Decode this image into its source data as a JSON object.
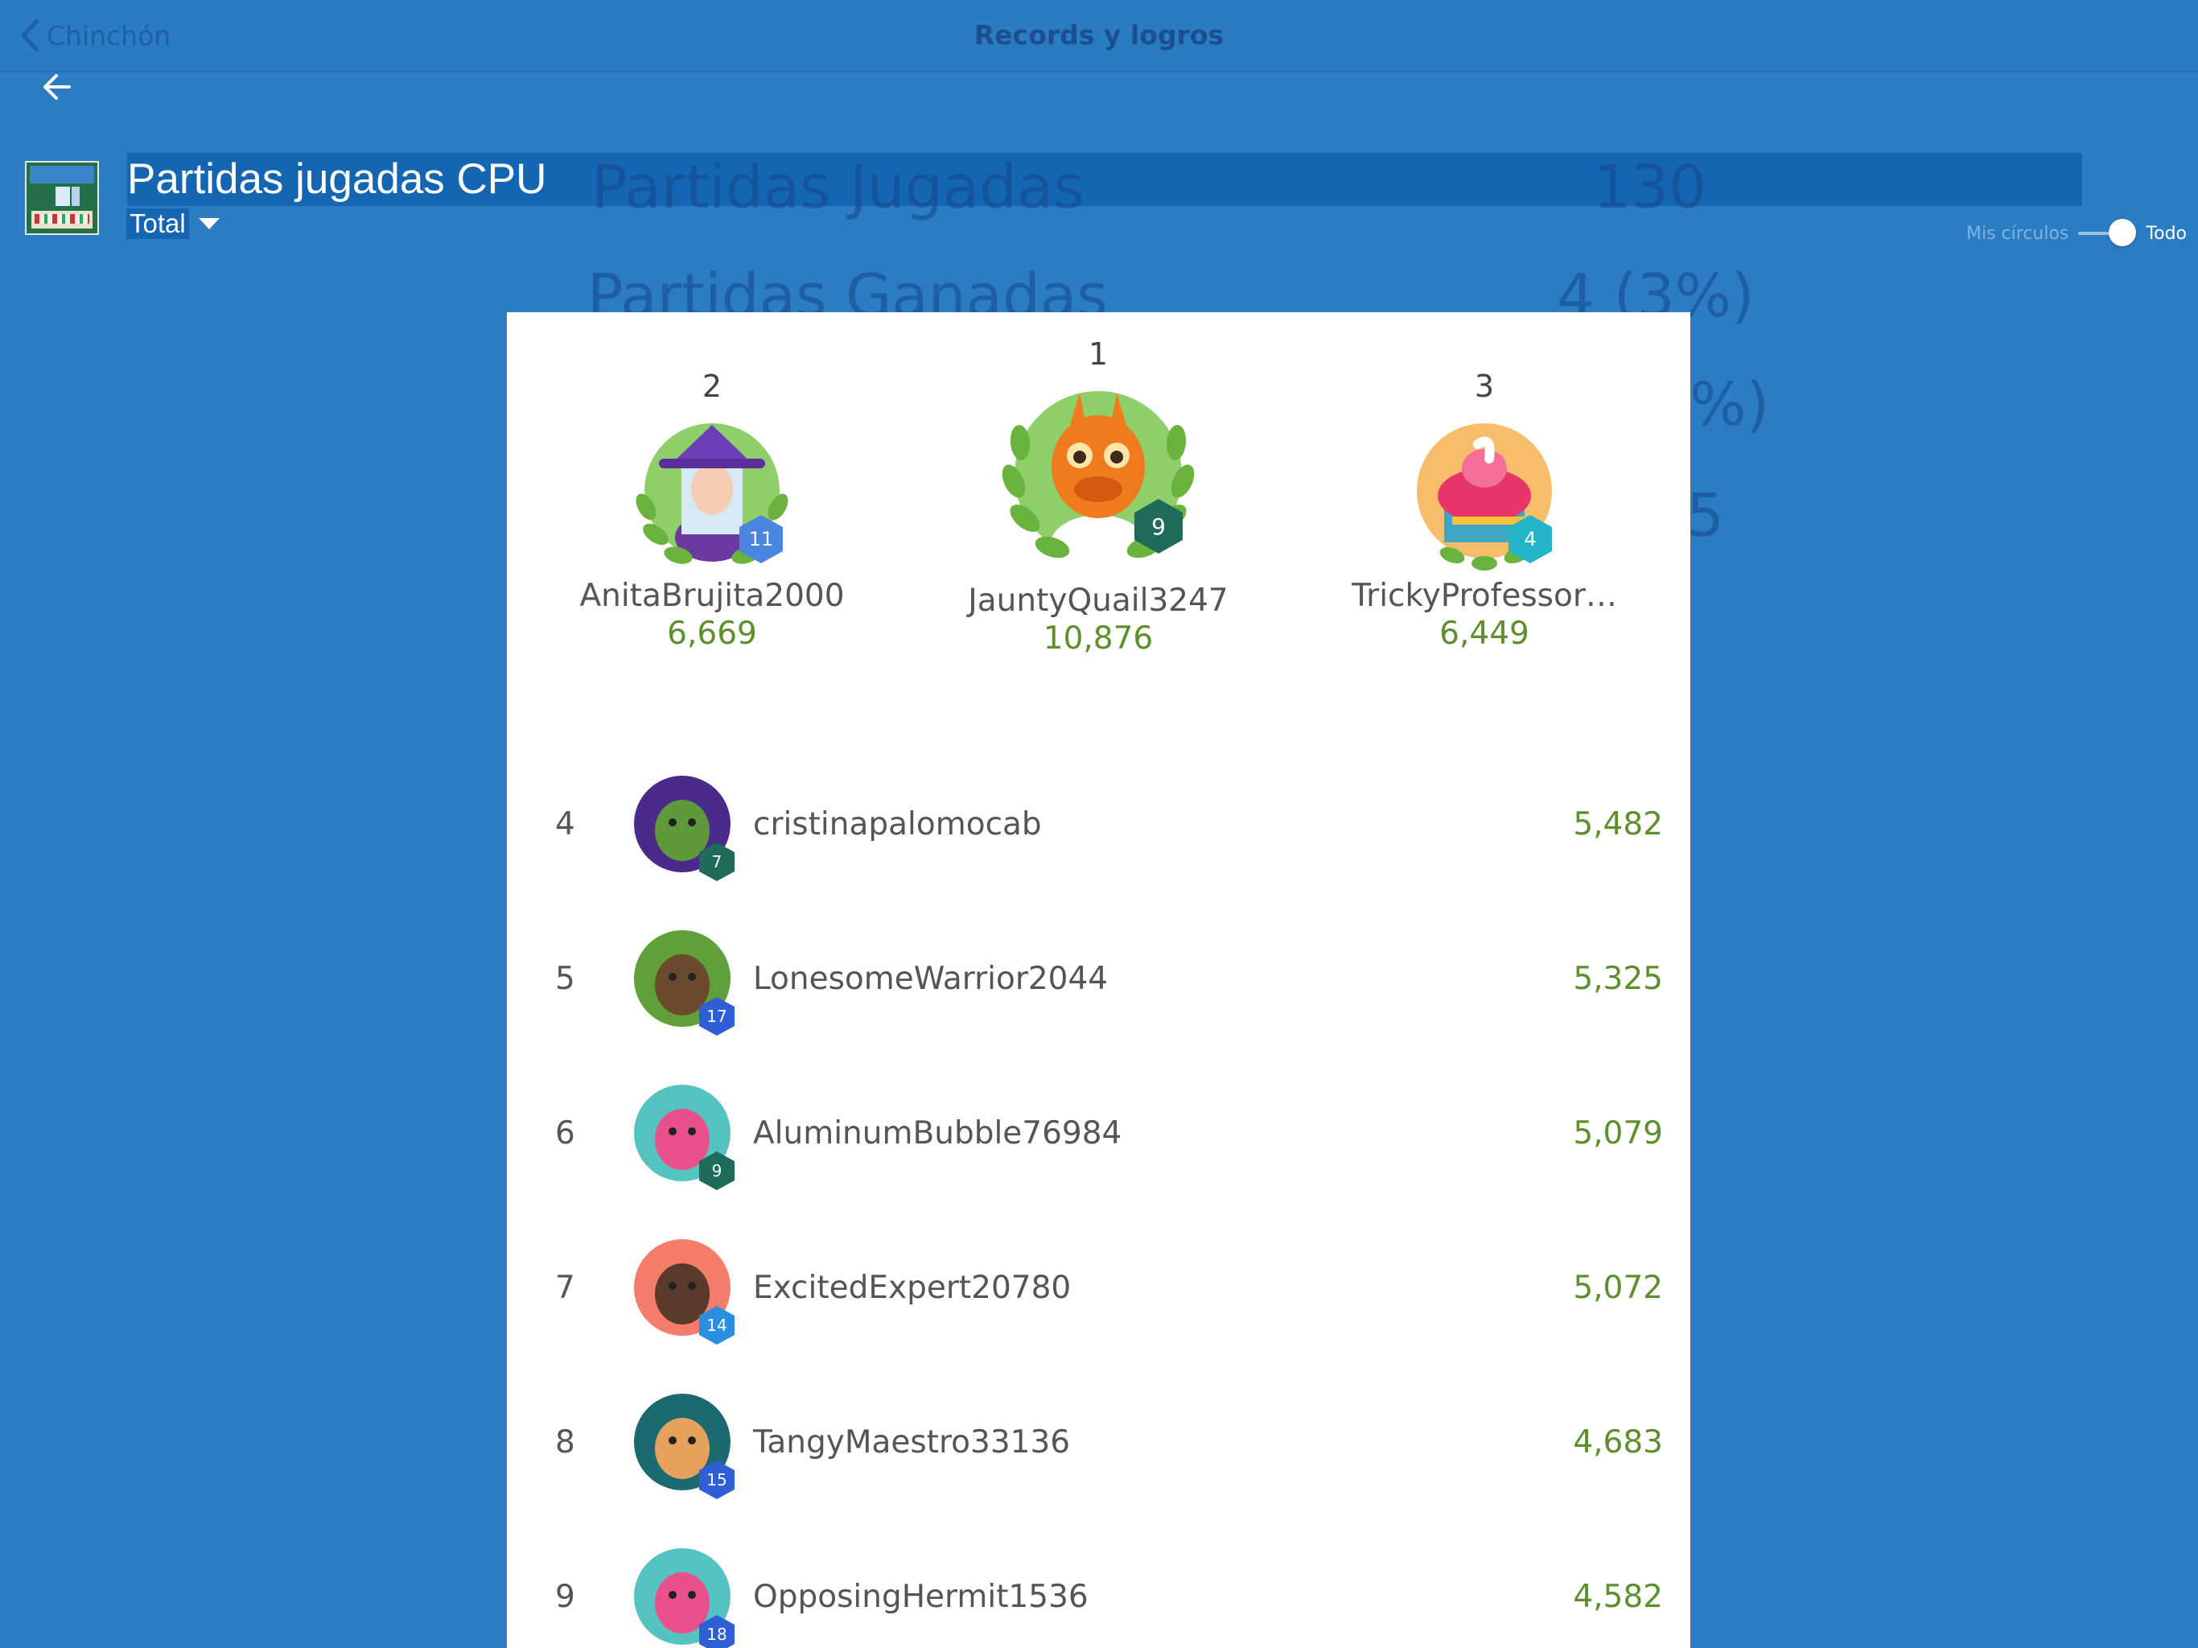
{
  "nav": {
    "back_label": "Chinchón",
    "title": "Records y logros"
  },
  "header": {
    "title": "Partidas jugadas CPU",
    "period": "Total"
  },
  "toggle": {
    "left_label": "Mis círculos",
    "right_label": "Todo",
    "value": "Todo"
  },
  "background_stats": {
    "played_label": "Partidas Jugadas",
    "played_value": "130",
    "won_label": "Partidas Ganadas",
    "won_value": "4 (3%)",
    "partial_1": "%)",
    "partial_2": "5"
  },
  "podium": [
    {
      "rank": "2",
      "name": "AnitaBrujita2000",
      "score": "6,669",
      "level": "11",
      "badge_color": "#4a86e0",
      "avatar": "witch-avatar-icon"
    },
    {
      "rank": "1",
      "name": "JauntyQuail3247",
      "score": "10,876",
      "level": "9",
      "badge_color": "#1e6b5a",
      "avatar": "dragon-avatar-icon"
    },
    {
      "rank": "3",
      "name": "TrickyProfessor…",
      "score": "6,449",
      "level": "4",
      "badge_color": "#25b5c9",
      "avatar": "cupcake-avatar-icon"
    }
  ],
  "rows": [
    {
      "rank": "4",
      "name": "cristinapalomocab",
      "score": "5,482",
      "level": "7",
      "badge_color": "#1e6b5a",
      "avatar": "soldier-avatar-icon"
    },
    {
      "rank": "5",
      "name": "LonesomeWarrior2044",
      "score": "5,325",
      "level": "17",
      "badge_color": "#2e5fd6",
      "avatar": "bear-avatar-icon"
    },
    {
      "rank": "6",
      "name": "AluminumBubble76984",
      "score": "5,079",
      "level": "9",
      "badge_color": "#1e6b5a",
      "avatar": "narwhal-avatar-icon"
    },
    {
      "rank": "7",
      "name": "ExcitedExpert20780",
      "score": "5,072",
      "level": "14",
      "badge_color": "#2a8fe0",
      "avatar": "rooster-avatar-icon"
    },
    {
      "rank": "8",
      "name": "TangyMaestro33136",
      "score": "4,683",
      "level": "15",
      "badge_color": "#2e5fd6",
      "avatar": "pirate-avatar-icon"
    },
    {
      "rank": "9",
      "name": "OpposingHermit1536",
      "score": "4,582",
      "level": "18",
      "badge_color": "#2e5fd6",
      "avatar": "narwhal-avatar-icon"
    }
  ]
}
